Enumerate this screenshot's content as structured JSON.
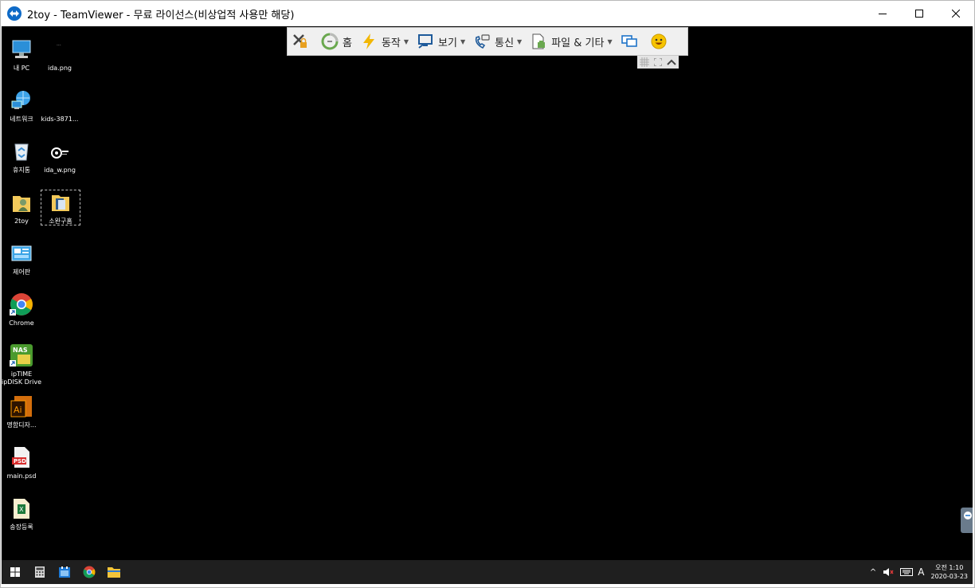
{
  "window": {
    "title": "2toy - TeamViewer - 무료 라이선스(비상업적 사용만 해당)"
  },
  "toolbar": {
    "items": [
      {
        "label": "",
        "icon": "close-session-icon"
      },
      {
        "label": "홈",
        "icon": "home-icon"
      },
      {
        "label": "동작",
        "icon": "lightning-icon"
      },
      {
        "label": "보기",
        "icon": "view-monitor-icon"
      },
      {
        "label": "통신",
        "icon": "phone-chat-icon"
      },
      {
        "label": "파일 & 기타",
        "icon": "file-transfer-icon"
      }
    ]
  },
  "desktop": {
    "icons": [
      {
        "label": "내 PC",
        "icon": "computer-icon"
      },
      {
        "label": "ida.png",
        "icon": "image-file-icon"
      },
      {
        "label": "네트워크",
        "icon": "network-icon"
      },
      {
        "label": "kids-3871...",
        "icon": "image-file-icon"
      },
      {
        "label": "휴지통",
        "icon": "recycle-bin-icon"
      },
      {
        "label": "ida_w.png",
        "icon": "image-file-icon"
      },
      {
        "label": "2toy",
        "icon": "user-folder-icon"
      },
      {
        "label": "소완구홈",
        "icon": "folder-icon"
      },
      {
        "label": "제어판",
        "icon": "control-panel-icon"
      },
      {
        "label": "Chrome",
        "icon": "chrome-icon"
      },
      {
        "label": "ipTIME ipDISK Drive",
        "icon": "nas-icon"
      },
      {
        "label": "명함디자...",
        "icon": "illustrator-icon"
      },
      {
        "label": "main.psd",
        "icon": "psd-file-icon"
      },
      {
        "label": "송장등록",
        "icon": "excel-file-icon"
      }
    ]
  },
  "taskbar": {
    "ime": "A",
    "time": "오전 1:10",
    "date": "2020-03-23"
  }
}
